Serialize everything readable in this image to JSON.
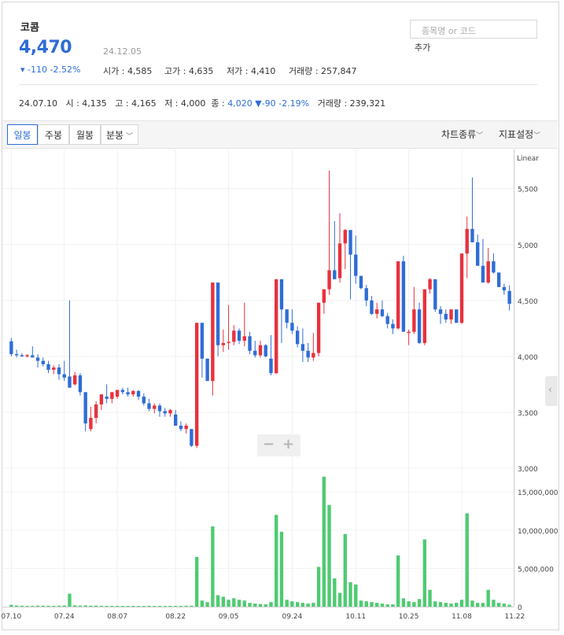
{
  "stock": {
    "name": "코콤",
    "price": "4,470",
    "date": "24.12.05",
    "change": "▾ -110 -2.52%",
    "open_label": "시가 : 4,585",
    "high_label": "고가 : 4,635",
    "low_label": "저가 : 4,410",
    "volume_label": "거래량 : 257,847"
  },
  "search": {
    "placeholder": "종목명 or 코드",
    "add_label": "추가"
  },
  "history": {
    "date": "24.07.10",
    "open": "시 : 4,135",
    "high": "고 : 4,165",
    "low": "저 : 4,000",
    "close_label": "종 : ",
    "close_value": "4,020",
    "change": "▼-90 -2.19%",
    "volume": "거래량 : 239,321"
  },
  "toolbar": {
    "tabs": [
      "일봉",
      "주봉",
      "월봉",
      "분봉"
    ],
    "chart_type": "차트종류",
    "indicator": "지표설정"
  },
  "colors": {
    "up": "#e8313d",
    "down": "#2e6dd6",
    "volume": "#4ecb71",
    "accent": "#2e6dd6"
  },
  "chart_data": {
    "type": "candlestick",
    "scale_label": "Linear",
    "price_ticks": [
      "5,500",
      "5,000",
      "4,500",
      "4,000",
      "3,500",
      "3,000"
    ],
    "price_tick_values": [
      5500,
      5000,
      4500,
      4000,
      3500,
      3000
    ],
    "volume_ticks": [
      "15,000,000",
      "10,000,000",
      "5,000,000",
      "0"
    ],
    "volume_tick_values": [
      15000000,
      10000000,
      5000000,
      0
    ],
    "x_labels": [
      "07.10",
      "07.24",
      "08.07",
      "08.22",
      "09.05",
      "09.24",
      "10.11",
      "10.25",
      "11.08",
      "11.22"
    ],
    "x_label_index": [
      0,
      10,
      20,
      31,
      41,
      53,
      65,
      75,
      85,
      95
    ],
    "price_range": [
      3000,
      5850
    ],
    "volume_range": [
      0,
      18000000
    ],
    "candles": [
      [
        4135,
        4165,
        4000,
        4020
      ],
      [
        4020,
        4060,
        3990,
        4010
      ],
      [
        4010,
        4030,
        3995,
        4005
      ],
      [
        4005,
        4020,
        3990,
        4010
      ],
      [
        4010,
        4090,
        4000,
        3990
      ],
      [
        3990,
        4020,
        3900,
        3960
      ],
      [
        3960,
        3990,
        3910,
        3930
      ],
      [
        3930,
        3960,
        3850,
        3880
      ],
      [
        3880,
        3920,
        3840,
        3900
      ],
      [
        3900,
        3930,
        3790,
        3840
      ],
      [
        3840,
        3960,
        3780,
        3810
      ],
      [
        3820,
        4500,
        3770,
        3720
      ],
      [
        3750,
        3860,
        3740,
        3830
      ],
      [
        3830,
        3850,
        3650,
        3680
      ],
      [
        3680,
        3640,
        3330,
        3400
      ],
      [
        3350,
        3550,
        3330,
        3450
      ],
      [
        3450,
        3600,
        3400,
        3570
      ],
      [
        3570,
        3650,
        3520,
        3660
      ],
      [
        3640,
        3750,
        3580,
        3620
      ],
      [
        3620,
        3680,
        3580,
        3680
      ],
      [
        3640,
        3700,
        3620,
        3700
      ],
      [
        3700,
        3720,
        3660,
        3680
      ],
      [
        3680,
        3720,
        3640,
        3660
      ],
      [
        3660,
        3700,
        3640,
        3690
      ],
      [
        3690,
        3700,
        3610,
        3640
      ],
      [
        3640,
        3670,
        3560,
        3580
      ],
      [
        3580,
        3620,
        3510,
        3530
      ],
      [
        3530,
        3580,
        3490,
        3560
      ],
      [
        3560,
        3580,
        3460,
        3510
      ],
      [
        3510,
        3540,
        3460,
        3490
      ],
      [
        3490,
        3530,
        3460,
        3520
      ],
      [
        3480,
        3520,
        3380,
        3380
      ],
      [
        3380,
        3420,
        3330,
        3350
      ],
      [
        3350,
        3400,
        3310,
        3380
      ],
      [
        3350,
        3300,
        3190,
        3200
      ],
      [
        3200,
        4300,
        3180,
        4300
      ],
      [
        4300,
        4240,
        3810,
        3980
      ],
      [
        3980,
        3950,
        3780,
        3780
      ],
      [
        3780,
        4660,
        3650,
        4660
      ],
      [
        4660,
        4620,
        4000,
        4100
      ],
      [
        4100,
        4240,
        4040,
        4120
      ],
      [
        4120,
        4460,
        4060,
        4130
      ],
      [
        4130,
        4280,
        4100,
        4230
      ],
      [
        4230,
        4250,
        4110,
        4140
      ],
      [
        4140,
        4480,
        4090,
        4180
      ],
      [
        4180,
        4220,
        4020,
        4050
      ],
      [
        4050,
        4140,
        3990,
        4010
      ],
      [
        4010,
        4140,
        3990,
        4100
      ],
      [
        4100,
        4110,
        3990,
        4000
      ],
      [
        3980,
        4190,
        3830,
        3850
      ],
      [
        3850,
        4380,
        3840,
        4690
      ],
      [
        4690,
        4610,
        4120,
        4420
      ],
      [
        4420,
        4400,
        4250,
        4300
      ],
      [
        4300,
        4420,
        4200,
        4230
      ],
      [
        4230,
        4270,
        4080,
        4110
      ],
      [
        4110,
        4250,
        3950,
        4050
      ],
      [
        4050,
        4120,
        3950,
        3990
      ],
      [
        3990,
        4210,
        3960,
        4030
      ],
      [
        4030,
        4320,
        4000,
        4480
      ],
      [
        4480,
        4540,
        4380,
        4600
      ],
      [
        4600,
        5660,
        4550,
        4770
      ],
      [
        4770,
        5210,
        4700,
        4690
      ],
      [
        4700,
        5280,
        4660,
        5010
      ],
      [
        5010,
        5140,
        4780,
        5130
      ],
      [
        5130,
        5020,
        4510,
        4910
      ],
      [
        4910,
        5080,
        4650,
        4720
      ],
      [
        4720,
        4700,
        4600,
        4610
      ],
      [
        4610,
        4640,
        4450,
        4500
      ],
      [
        4500,
        4540,
        4370,
        4380
      ],
      [
        4380,
        4480,
        4340,
        4420
      ],
      [
        4420,
        4500,
        4350,
        4360
      ],
      [
        4360,
        4390,
        4250,
        4290
      ],
      [
        4290,
        4330,
        4200,
        4250
      ],
      [
        4250,
        4380,
        4240,
        4850
      ],
      [
        4850,
        4900,
        4290,
        4220
      ],
      [
        4220,
        4240,
        4100,
        4220
      ],
      [
        4220,
        4620,
        4200,
        4420
      ],
      [
        4420,
        4480,
        4110,
        4120
      ],
      [
        4120,
        4560,
        4100,
        4600
      ],
      [
        4600,
        4700,
        4560,
        4690
      ],
      [
        4690,
        4540,
        4400,
        4420
      ],
      [
        4420,
        4450,
        4290,
        4380
      ],
      [
        4380,
        4420,
        4300,
        4330
      ],
      [
        4330,
        4410,
        4290,
        4420
      ],
      [
        4420,
        4420,
        4300,
        4300
      ],
      [
        4300,
        4550,
        4290,
        4920
      ],
      [
        4920,
        5250,
        4700,
        5140
      ],
      [
        5140,
        5600,
        5040,
        5020
      ],
      [
        5020,
        5090,
        4820,
        4810
      ],
      [
        4810,
        5050,
        4680,
        4660
      ],
      [
        4660,
        4970,
        4650,
        4850
      ],
      [
        4850,
        4920,
        4740,
        4750
      ],
      [
        4750,
        4710,
        4620,
        4620
      ],
      [
        4620,
        4650,
        4550,
        4590
      ],
      [
        4585,
        4635,
        4410,
        4470
      ]
    ],
    "volumes": [
      239321,
      150000,
      120000,
      100000,
      110000,
      140000,
      130000,
      120000,
      110000,
      130000,
      150000,
      1700000,
      180000,
      140000,
      160000,
      130000,
      140000,
      120000,
      110000,
      100000,
      110000,
      90000,
      100000,
      100000,
      90000,
      100000,
      110000,
      100000,
      100000,
      90000,
      100000,
      110000,
      100000,
      120000,
      130000,
      6500000,
      800000,
      600000,
      10500000,
      1500000,
      1300000,
      900000,
      1100000,
      900000,
      800000,
      500000,
      400000,
      350000,
      300000,
      600000,
      12000000,
      9800000,
      900000,
      700000,
      600000,
      500000,
      400000,
      500000,
      5200000,
      17000000,
      13300000,
      3700000,
      1800000,
      9500000,
      3200000,
      2900000,
      800000,
      700000,
      600000,
      500000,
      400000,
      300000,
      300000,
      6700000,
      1100000,
      700000,
      600000,
      1000000,
      8800000,
      2200000,
      700000,
      600000,
      500000,
      400000,
      500000,
      900000,
      12200000,
      800000,
      500000,
      500000,
      2200000,
      900000,
      500000,
      400000,
      257847
    ]
  }
}
